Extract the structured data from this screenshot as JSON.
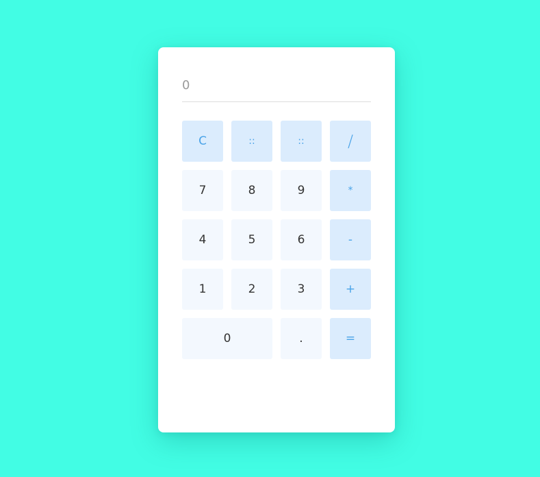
{
  "display": {
    "value": "0"
  },
  "keys": {
    "clear": "C",
    "paren_open": "::",
    "paren_close": "::",
    "divide": "/",
    "seven": "7",
    "eight": "8",
    "nine": "9",
    "multiply": "*",
    "four": "4",
    "five": "5",
    "six": "6",
    "subtract": "-",
    "one": "1",
    "two": "2",
    "three": "3",
    "add": "+",
    "zero": "0",
    "decimal": ".",
    "equals": "="
  },
  "colors": {
    "background": "#42fde4",
    "card": "#ffffff",
    "number_key": "#f3f8fe",
    "operator_key": "#dbecfd",
    "operator_text": "#4aa3e8",
    "number_text": "#333333"
  }
}
